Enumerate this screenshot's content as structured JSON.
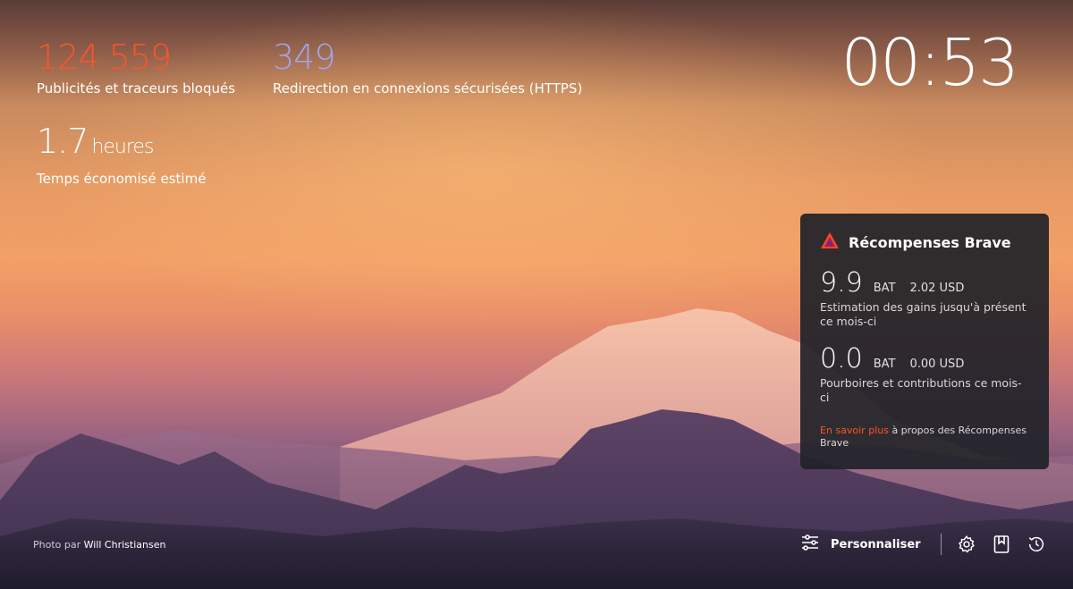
{
  "stats": {
    "ads_blocked": {
      "value": "124 559",
      "label": "Publicités et traceurs bloqués"
    },
    "https_upgrades": {
      "value": "349",
      "label": "Redirection en connexions sécurisées (HTTPS)"
    },
    "time_saved": {
      "value": "1.7",
      "unit": "heures",
      "label": "Temps économisé estimé"
    }
  },
  "clock": "00:53",
  "rewards": {
    "title": "Récompenses Brave",
    "earnings": {
      "amount": "9.9",
      "currency": "BAT",
      "usd": "2.02 USD",
      "description": "Estimation des gains jusqu'à présent ce mois-ci"
    },
    "tips": {
      "amount": "0.0",
      "currency": "BAT",
      "usd": "0.00 USD",
      "description": "Pourboires et contributions ce mois-ci"
    },
    "footer_link": "En savoir plus",
    "footer_text": " à propos des Récompenses Brave"
  },
  "credit": {
    "prefix": "Photo par ",
    "author": "Will Christiansen"
  },
  "toolbar": {
    "customize_label": "Personnaliser",
    "icons": [
      "sliders-icon",
      "gear-icon",
      "bookmarks-icon",
      "history-icon"
    ]
  },
  "colors": {
    "ads_accent": "#fb542b",
    "https_accent": "#a0a5eb",
    "link": "#fb542b",
    "panel": "#202228"
  }
}
